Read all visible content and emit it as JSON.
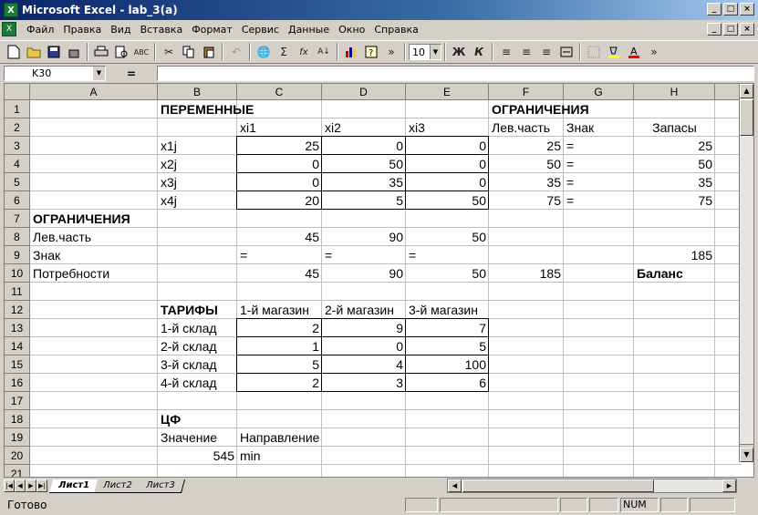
{
  "window": {
    "title": "Microsoft Excel - lab_3(a)",
    "app_icon": "X",
    "buttons": [
      "_",
      "□",
      "×"
    ]
  },
  "menu": {
    "items": [
      "Файл",
      "Правка",
      "Вид",
      "Вставка",
      "Формат",
      "Сервис",
      "Данные",
      "Окно",
      "Справка"
    ]
  },
  "toolbar": {
    "font_size": "10",
    "bold": "Ж",
    "italic": "К",
    "sigma": "Σ",
    "fx": "fx",
    "more": "»"
  },
  "formula_bar": {
    "name_box": "K30",
    "equals": "=",
    "value": ""
  },
  "columns": [
    "A",
    "B",
    "C",
    "D",
    "E",
    "F",
    "G",
    "H"
  ],
  "rows": [
    "1",
    "2",
    "3",
    "4",
    "5",
    "6",
    "7",
    "8",
    "9",
    "10",
    "11",
    "12",
    "13",
    "14",
    "15",
    "16",
    "17",
    "18",
    "19",
    "20",
    "21"
  ],
  "cells": {
    "B1": "ПЕРЕМЕННЫЕ",
    "F1": "ОГРАНИЧЕНИЯ",
    "C2": "xi1",
    "D2": "xi2",
    "E2": "xi3",
    "F2": "Лев.часть",
    "G2": "Знак",
    "H2": "Запасы",
    "B3": "x1j",
    "C3": "25",
    "D3": "0",
    "E3": "0",
    "F3": "25",
    "G3": "=",
    "H3": "25",
    "B4": "x2j",
    "C4": "0",
    "D4": "50",
    "E4": "0",
    "F4": "50",
    "G4": "=",
    "H4": "50",
    "B5": "x3j",
    "C5": "0",
    "D5": "35",
    "E5": "0",
    "F5": "35",
    "G5": "=",
    "H5": "35",
    "B6": "x4j",
    "C6": "20",
    "D6": "5",
    "E6": "50",
    "F6": "75",
    "G6": "=",
    "H6": "75",
    "A7": "ОГРАНИЧЕНИЯ",
    "A8": "Лев.часть",
    "C8": "45",
    "D8": "90",
    "E8": "50",
    "A9": "Знак",
    "C9": "=",
    "D9": "=",
    "E9": "=",
    "H9": "185",
    "A10": "Потребности",
    "C10": "45",
    "D10": "90",
    "E10": "50",
    "F10": "185",
    "H10": "Баланс",
    "B12": "ТАРИФЫ",
    "C12": "1-й магазин",
    "D12": "2-й магазин",
    "E12": "3-й магазин",
    "B13": "1-й склад",
    "C13": "2",
    "D13": "9",
    "E13": "7",
    "B14": "2-й склад",
    "C14": "1",
    "D14": "0",
    "E14": "5",
    "B15": "3-й склад",
    "C15": "5",
    "D15": "4",
    "E15": "100",
    "B16": "4-й склад",
    "C16": "2",
    "D16": "3",
    "E16": "6",
    "B18": "ЦФ",
    "B19": "Значение",
    "C19": "Направление",
    "B20": "545",
    "C20": "min"
  },
  "sheets": [
    "Лист1",
    "Лист2",
    "Лист3"
  ],
  "active_sheet": "Лист1",
  "status": {
    "text": "Готово",
    "num": "NUM"
  }
}
